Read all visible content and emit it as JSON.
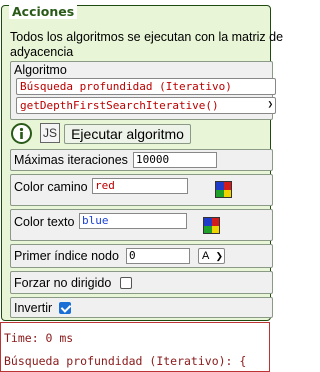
{
  "panel": {
    "legend": "Acciones",
    "description_line1": "Todos los algoritmos se ejecutan con la matriz de",
    "description_line2": "adyacencia"
  },
  "algorithm": {
    "label": "Algoritmo",
    "selected_name": "Búsqueda profundidad (Iterativo)",
    "selected_method": "getDepthFirstSearchIterative()",
    "info_icon": "info-circle-icon",
    "js_label": "JS",
    "run_label": "Ejecutar algoritmo"
  },
  "max_iterations": {
    "label": "Máximas iteraciones",
    "value": "10000"
  },
  "path_color": {
    "label": "Color camino",
    "value": "red"
  },
  "text_color": {
    "label": "Color texto",
    "value": "blue"
  },
  "first_node_index": {
    "label": "Primer índice nodo",
    "value": "0",
    "option": "A"
  },
  "force_undirected": {
    "label": "Forzar no dirigido",
    "checked": false
  },
  "invert": {
    "label": "Invertir",
    "checked": true
  },
  "output": {
    "line1": "Time: 0 ms",
    "line2": "Búsqueda profundidad (Iterativo): {"
  },
  "colors": {
    "panel_bg": "#e8f5d6",
    "legend": "#2a5a17",
    "output_text": "#8a1a1a",
    "accent": "#1a6fd6"
  }
}
